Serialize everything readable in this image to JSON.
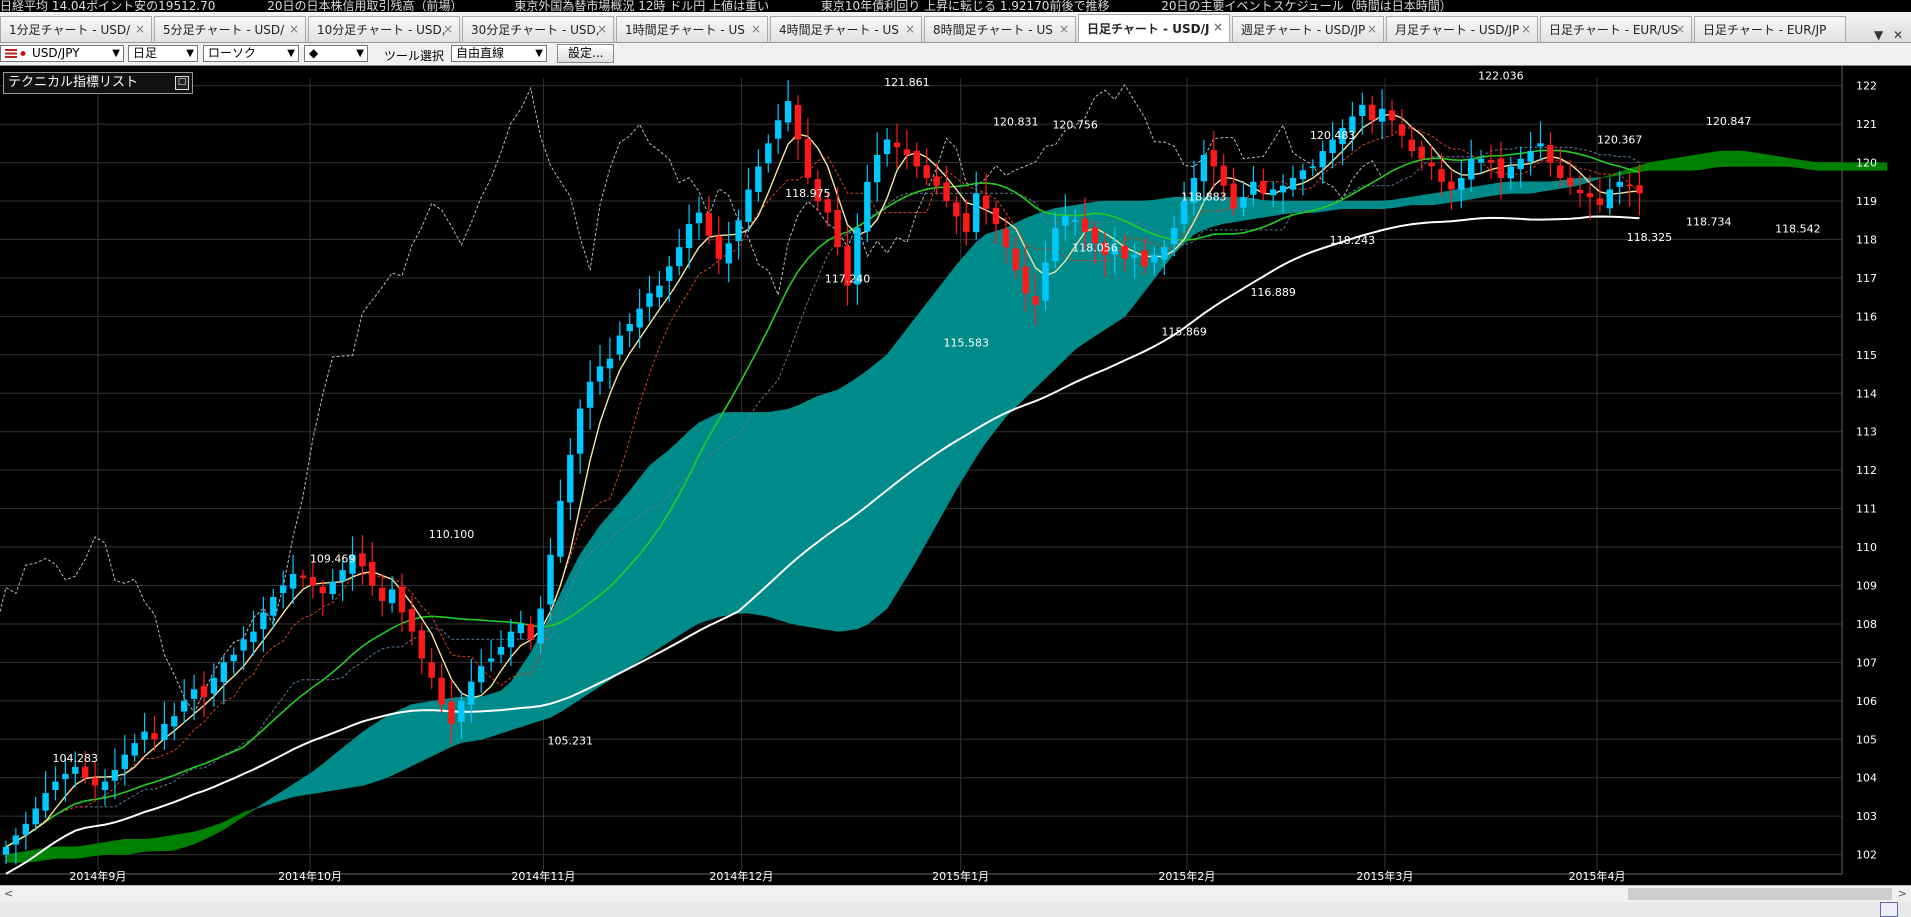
{
  "ticker": {
    "items": [
      "日経平均 14.04ポイント安の19512.70",
      "20日の日本株信用取引残高（前場）",
      "東京外国為替市場概況 12時 ドル円 上値は重い",
      "東京10年債利回り 上昇に転じる 1.92170前後で推移",
      "20日の主要イベントスケジュール（時間は日本時間）"
    ]
  },
  "tabs": [
    {
      "label": "1分足チャート - USD/"
    },
    {
      "label": "5分足チャート - USD/"
    },
    {
      "label": "10分足チャート - USD,"
    },
    {
      "label": "30分足チャート - USD,"
    },
    {
      "label": "1時間足チャート - US"
    },
    {
      "label": "4時間足チャート - US"
    },
    {
      "label": "8時間足チャート - US"
    },
    {
      "label": "日足チャート - USD/J",
      "active": true
    },
    {
      "label": "週足チャート - USD/JP"
    },
    {
      "label": "月足チャート - USD/JP"
    },
    {
      "label": "日足チャート - EUR/US"
    },
    {
      "label": "日足チャート - EUR/JP"
    }
  ],
  "tab_close_glyph": "×",
  "tab_menu_glyph": "▼",
  "window_close_glyph": "✕",
  "toolbar": {
    "pair": "USD/JPY",
    "period": "日足",
    "chart_style": "ローソク",
    "color_swatch": "◆",
    "tool_label": "ツール選択",
    "tool_value": "自由直線",
    "settings_label": "設定..."
  },
  "panel": {
    "title": "テクニカル指標リスト",
    "toggle": "□"
  },
  "scrollbar": {
    "left_arrow": "<",
    "right_arrow": ">"
  },
  "colors": {
    "background": "#000000",
    "grid": "#333333",
    "bull_candle": "#00c8ff",
    "bear_candle": "#ff1a1a",
    "cloud_bull": "#008000",
    "cloud_bear": "#008b8b",
    "tenkan": "#f5e6a0",
    "kijun": "#d64020",
    "sma_short": "#22cc22",
    "sma_long": "#ffffff",
    "chikou": "#bbbbbb",
    "span_line": "#5a7a9a",
    "axis_text": "#ffffff"
  },
  "chart_data": {
    "type": "candlestick",
    "title": "",
    "xlabel": "",
    "ylabel": "",
    "ylim": [
      101.6,
      122.2
    ],
    "y_ticks": [
      102,
      103,
      104,
      105,
      106,
      107,
      108,
      109,
      110,
      111,
      112,
      113,
      114,
      115,
      116,
      117,
      118,
      119,
      120,
      121,
      122
    ],
    "x_ticks": [
      {
        "date": "2014-09-01",
        "label": "2014年9月"
      },
      {
        "date": "2014-10-01",
        "label": "2014年10月"
      },
      {
        "date": "2014-11-03",
        "label": "2014年11月"
      },
      {
        "date": "2014-12-01",
        "label": "2014年12月"
      },
      {
        "date": "2015-01-01",
        "label": "2015年1月"
      },
      {
        "date": "2015-02-02",
        "label": "2015年2月"
      },
      {
        "date": "2015-03-02",
        "label": "2015年3月"
      },
      {
        "date": "2015-04-01",
        "label": "2015年4月"
      }
    ],
    "closes": [
      102.2,
      102.5,
      102.8,
      103.2,
      103.6,
      103.9,
      104.1,
      104.28,
      104.0,
      103.8,
      103.9,
      104.2,
      104.6,
      104.9,
      105.2,
      105.0,
      105.4,
      105.6,
      106.0,
      106.3,
      106.1,
      106.6,
      107.0,
      107.2,
      107.6,
      107.8,
      108.3,
      108.7,
      109.0,
      109.3,
      109.2,
      109.0,
      108.8,
      109.1,
      109.4,
      109.8,
      109.5,
      109.0,
      108.6,
      108.9,
      108.3,
      107.8,
      107.1,
      106.6,
      105.9,
      105.4,
      106.0,
      106.5,
      106.9,
      107.1,
      107.4,
      107.8,
      108.0,
      107.6,
      108.4,
      109.8,
      111.2,
      112.4,
      113.6,
      114.3,
      114.7,
      114.9,
      115.5,
      115.8,
      116.2,
      116.6,
      116.8,
      117.3,
      117.8,
      118.4,
      118.7,
      118.1,
      117.5,
      117.9,
      118.5,
      119.3,
      119.9,
      120.5,
      121.1,
      121.6,
      120.6,
      119.6,
      119.0,
      118.7,
      117.8,
      116.8,
      118.3,
      119.5,
      120.2,
      120.6,
      120.4,
      120.2,
      119.9,
      119.6,
      119.4,
      119.0,
      118.6,
      118.2,
      119.2,
      118.8,
      118.4,
      117.8,
      117.2,
      116.6,
      116.3,
      117.4,
      118.3,
      118.6,
      118.5,
      118.2,
      117.9,
      117.6,
      117.8,
      117.5,
      117.6,
      117.3,
      117.6,
      117.8,
      118.3,
      119.0,
      119.6,
      120.2,
      119.9,
      119.4,
      118.8,
      119.1,
      119.5,
      119.2,
      119.3,
      119.4,
      119.6,
      119.8,
      119.9,
      120.3,
      120.6,
      120.9,
      121.2,
      121.5,
      121.1,
      121.4,
      121.1,
      120.7,
      120.3,
      120.1,
      119.9,
      119.5,
      119.3,
      119.6,
      120.1,
      120.1,
      120.0,
      119.6,
      119.9,
      120.1,
      120.3,
      120.5,
      120.0,
      119.6,
      119.4,
      119.2,
      119.1,
      118.9,
      119.3,
      119.5,
      119.4,
      119.2
    ],
    "ichimoku_cloud": {
      "span_a": [
        102.0,
        102.1,
        102.2,
        102.2,
        102.3,
        102.4,
        102.4,
        102.5,
        102.6,
        102.8,
        103.1,
        103.3,
        103.5,
        103.6,
        103.7,
        103.8,
        104.0,
        104.3,
        104.6,
        104.9,
        105.0,
        105.2,
        105.4,
        105.6,
        106.0,
        106.4,
        106.8,
        107.2,
        107.6,
        108.0,
        108.2,
        108.3,
        108.2,
        108.0,
        107.9,
        107.8,
        107.9,
        108.4,
        109.4,
        110.5,
        111.6,
        112.6,
        113.4,
        114.0,
        114.6,
        115.2,
        115.6,
        116.0,
        116.8,
        117.6,
        118.2,
        118.4,
        118.5,
        118.6,
        118.7,
        118.7,
        118.8,
        118.8,
        118.8,
        118.9,
        118.9,
        119.0,
        119.1,
        119.2,
        119.2,
        119.3,
        119.4,
        119.6,
        119.8,
        120.0,
        120.1,
        120.2,
        120.3,
        120.3,
        120.2,
        120.1,
        120.0,
        120.0,
        120.0,
        120.0
      ],
      "span_b": [
        101.8,
        101.8,
        101.9,
        101.9,
        102.0,
        102.0,
        102.1,
        102.1,
        102.3,
        102.6,
        103.0,
        103.4,
        103.8,
        104.2,
        104.7,
        105.2,
        105.6,
        105.9,
        106.0,
        106.1,
        106.1,
        106.3,
        107.2,
        108.4,
        109.7,
        110.6,
        111.3,
        112.1,
        112.6,
        113.2,
        113.5,
        113.5,
        113.5,
        113.6,
        113.9,
        114.1,
        114.5,
        115.0,
        115.8,
        116.6,
        117.4,
        118.1,
        118.3,
        118.6,
        118.8,
        118.9,
        119.0,
        119.0,
        119.0,
        119.1,
        119.1,
        119.1,
        119.1,
        119.0,
        119.0,
        119.0,
        119.0,
        119.0,
        119.0,
        119.1,
        119.2,
        119.3,
        119.4,
        119.5,
        119.5,
        119.5,
        119.6,
        119.6,
        119.7,
        119.8,
        119.8,
        119.8,
        119.9,
        119.9,
        119.9,
        119.9,
        119.8,
        119.8,
        119.8,
        119.8
      ],
      "extends_ahead": 25
    },
    "annotations": [
      {
        "text": "104.283",
        "index": 7,
        "price": 104.283,
        "position": "above"
      },
      {
        "text": "109.469",
        "index": 33,
        "price": 109.469,
        "position": "above"
      },
      {
        "text": "110.100",
        "index": 45,
        "price": 110.1,
        "position": "above"
      },
      {
        "text": "105.231",
        "index": 57,
        "price": 105.231,
        "position": "below"
      },
      {
        "text": "118.975",
        "index": 81,
        "price": 118.975,
        "position": "above"
      },
      {
        "text": "117.240",
        "index": 85,
        "price": 117.24,
        "position": "below"
      },
      {
        "text": "121.861",
        "index": 91,
        "price": 121.861,
        "position": "above"
      },
      {
        "text": "115.583",
        "index": 97,
        "price": 115.583,
        "position": "below"
      },
      {
        "text": "120.831",
        "index": 102,
        "price": 120.831,
        "position": "above"
      },
      {
        "text": "120.756",
        "index": 108,
        "price": 120.756,
        "position": "above"
      },
      {
        "text": "118.056",
        "index": 110,
        "price": 118.056,
        "position": "below"
      },
      {
        "text": "115.869",
        "index": 119,
        "price": 115.869,
        "position": "below"
      },
      {
        "text": "118.883",
        "index": 121,
        "price": 118.883,
        "position": "above"
      },
      {
        "text": "116.889",
        "index": 128,
        "price": 116.889,
        "position": "below"
      },
      {
        "text": "120.483",
        "index": 134,
        "price": 120.483,
        "position": "above"
      },
      {
        "text": "118.243",
        "index": 136,
        "price": 118.243,
        "position": "below"
      },
      {
        "text": "122.036",
        "index": 151,
        "price": 122.036,
        "position": "above"
      },
      {
        "text": "120.367",
        "index": 163,
        "price": 120.367,
        "position": "above"
      },
      {
        "text": "118.325",
        "index": 166,
        "price": 118.325,
        "position": "below"
      },
      {
        "text": "118.734",
        "index": 172,
        "price": 118.734,
        "position": "below"
      },
      {
        "text": "120.847",
        "index": 174,
        "price": 120.847,
        "position": "above"
      },
      {
        "text": "118.542",
        "index": 181,
        "price": 118.542,
        "position": "below"
      }
    ]
  }
}
